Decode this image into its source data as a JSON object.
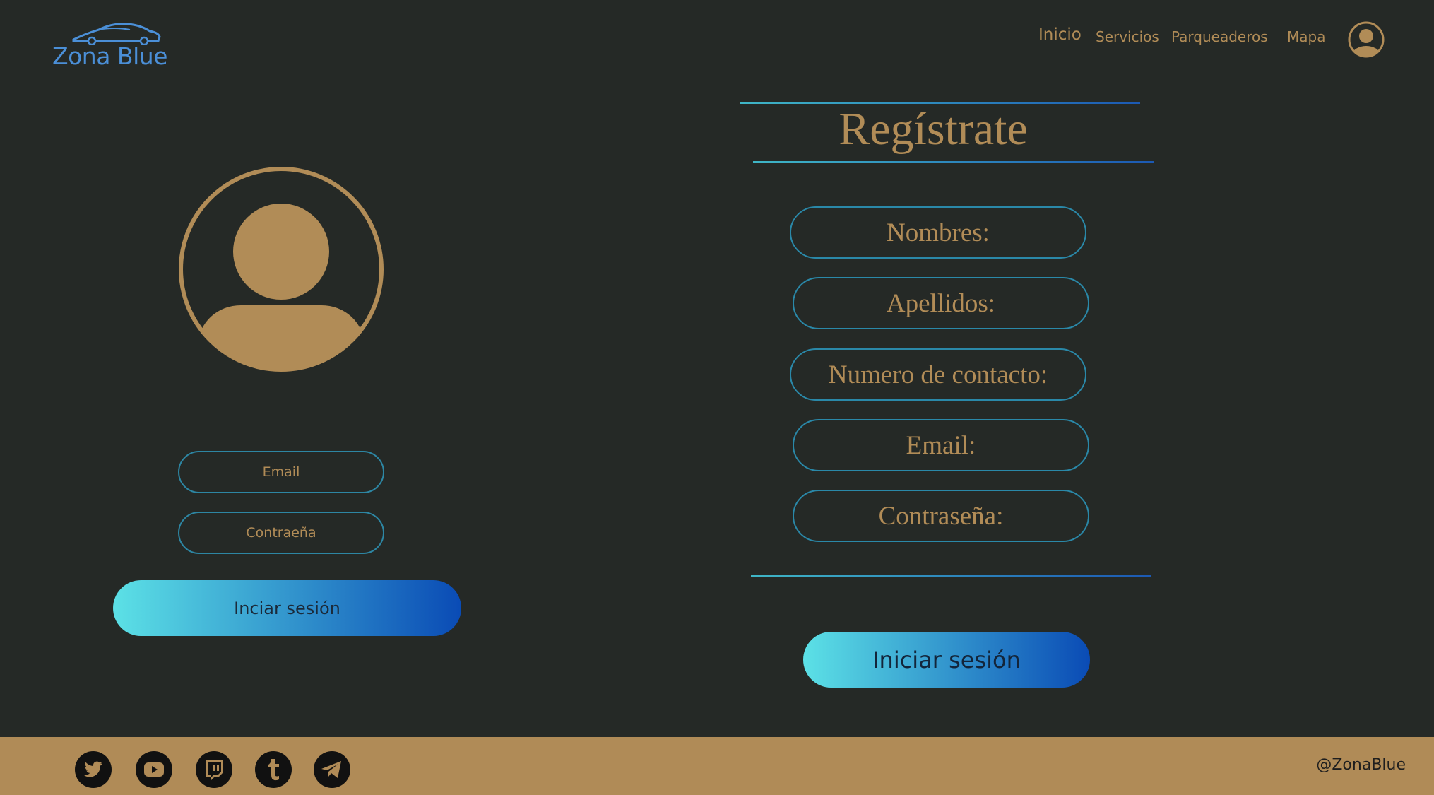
{
  "brand": {
    "name": "Zona Blue",
    "logo_color": "#4b8fd7"
  },
  "nav": {
    "inicio": "Inicio",
    "servicios": "Servicios",
    "parqueaderos": "Parqueaderos",
    "mapa": "Mapa"
  },
  "login": {
    "email_placeholder": "Email",
    "password_placeholder": "Contraeña",
    "submit_label": "Inciar sesión"
  },
  "register": {
    "title": "Regístrate",
    "fields": [
      "Nombres:",
      "Apellidos:",
      "Numero de contacto:",
      "Email:",
      "Contraseña:"
    ],
    "submit_label": "Iniciar sesión"
  },
  "footer": {
    "social_icons": [
      "twitter-icon",
      "youtube-icon",
      "twitch-icon",
      "tumblr-icon",
      "telegram-icon"
    ],
    "handle": "@ZonaBlue"
  },
  "colors": {
    "background": "#252926",
    "accent": "#b18c57",
    "footer": "#b08b57",
    "button_start": "#5ce1e6",
    "button_end": "#0a4bb5"
  }
}
